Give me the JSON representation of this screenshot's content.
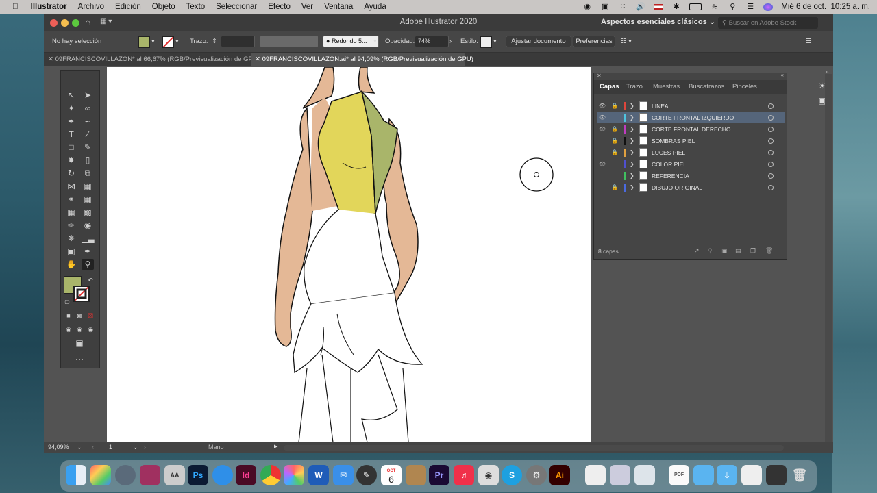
{
  "menubar": {
    "app": "Illustrator",
    "items": [
      "Archivo",
      "Edición",
      "Objeto",
      "Texto",
      "Seleccionar",
      "Efecto",
      "Ver",
      "Ventana",
      "Ayuda"
    ],
    "datetime": "Mié 6 de oct.  10:25 a. m."
  },
  "window": {
    "title": "Adobe Illustrator 2020",
    "workspace": "Aspectos esenciales clásicos",
    "stock_search_placeholder": "Buscar en Adobe Stock"
  },
  "control_bar": {
    "selection_label": "No hay selección",
    "fill_color": "#a9b56a",
    "stroke_label": "Trazo:",
    "brush": "Redondo 5...",
    "opacity_label": "Opacidad:",
    "opacity_value": "74%",
    "style_label": "Estilo:",
    "fit_document": "Ajustar documento",
    "preferences": "Preferencias"
  },
  "tabs": [
    {
      "label": "09FRANCISCOVILLAZON* al 66,67% (RGB/Previsualización de GPU)",
      "active": false
    },
    {
      "label": "09FRANCISCOVILLAZON.ai* al 94,09% (RGB/Previsualización de GPU)",
      "active": true
    }
  ],
  "layers_panel": {
    "tabs": [
      "Capas",
      "Trazo",
      "Muestras",
      "Buscatrazos",
      "Pinceles"
    ],
    "active_tab": "Capas",
    "layers": [
      {
        "name": "LINEA",
        "color": "#e0463c",
        "visible": true,
        "locked": true,
        "selected": false
      },
      {
        "name": "CORTE FRONTAL IZQUIERDO",
        "color": "#4fc4e0",
        "visible": true,
        "locked": false,
        "selected": true
      },
      {
        "name": "CORTE FRONTAL DERECHO",
        "color": "#c03cc0",
        "visible": true,
        "locked": true,
        "selected": false
      },
      {
        "name": "SOMBRAS PIEL",
        "color": "#111111",
        "visible": false,
        "locked": true,
        "selected": false
      },
      {
        "name": "LUCES PIEL",
        "color": "#e0a040",
        "visible": false,
        "locked": true,
        "selected": false
      },
      {
        "name": "COLOR PIEL",
        "color": "#5050d0",
        "visible": true,
        "locked": false,
        "selected": false
      },
      {
        "name": "REFERENCIA",
        "color": "#40c060",
        "visible": false,
        "locked": false,
        "selected": false
      },
      {
        "name": "DIBUJO ORIGINAL",
        "color": "#4a6ae0",
        "visible": false,
        "locked": true,
        "selected": false
      }
    ],
    "count_label": "8 capas"
  },
  "status_bar": {
    "zoom": "94,09%",
    "artboard": "1",
    "tool": "Mano"
  },
  "dock": {
    "calendar_month": "OCT",
    "calendar_day": "6"
  }
}
